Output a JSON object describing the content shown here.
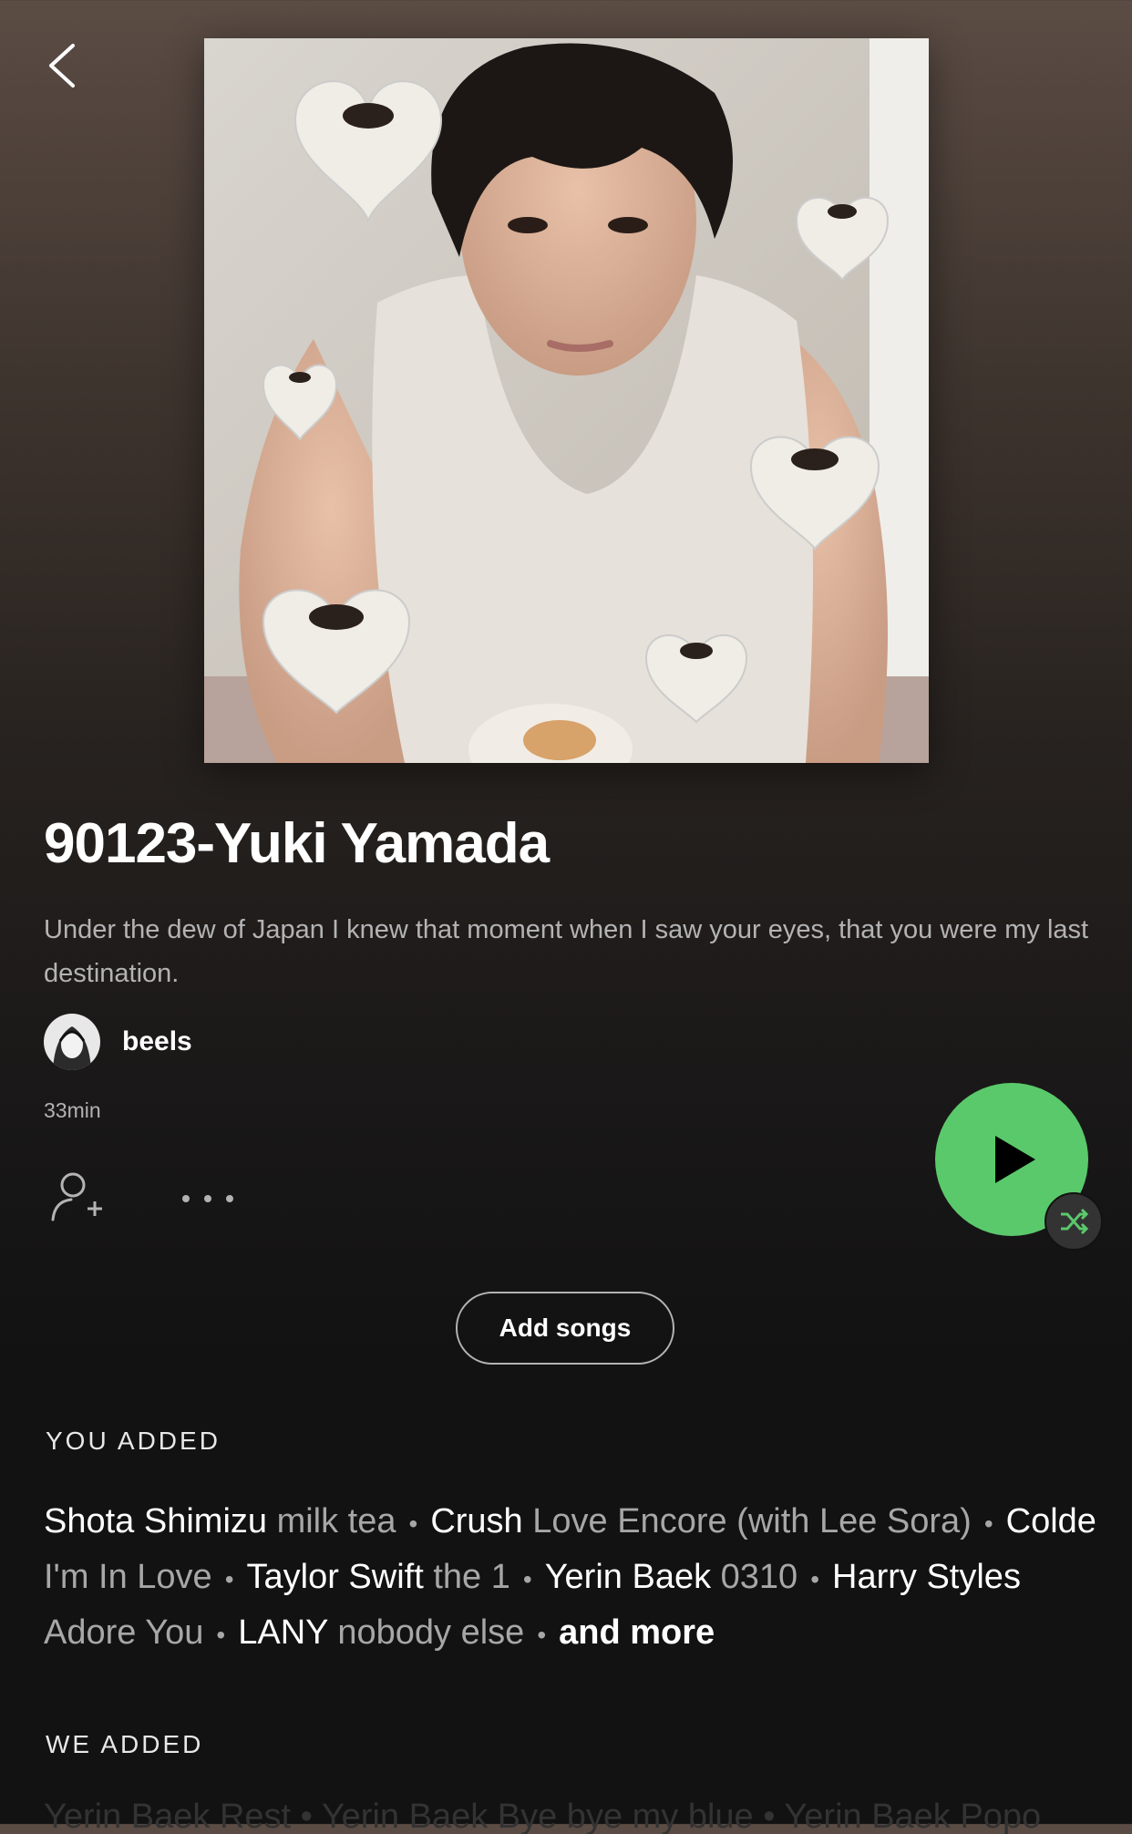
{
  "playlist": {
    "title": "90123-Yuki Yamada",
    "description": "Under the dew of Japan I knew that moment when I saw your eyes, that you were my last destination.",
    "owner": "beels",
    "duration": "33min"
  },
  "actions": {
    "add_songs_label": "Add songs"
  },
  "you_added": {
    "label": "YOU ADDED",
    "tracks": [
      {
        "artist": "Shota Shimizu",
        "song": "milk tea"
      },
      {
        "artist": "Crush",
        "song": "Love Encore (with Lee Sora)"
      },
      {
        "artist": "Colde",
        "song": "I'm In Love"
      },
      {
        "artist": "Taylor Swift",
        "song": "the 1"
      },
      {
        "artist": "Yerin Baek",
        "song": "0310"
      },
      {
        "artist": "Harry Styles",
        "song": "Adore You"
      },
      {
        "artist": "LANY",
        "song": "nobody else"
      }
    ],
    "and_more": "and more"
  },
  "we_added": {
    "label": "WE ADDED",
    "preview": "Yerin Baek Rest • Yerin Baek Bye bye my blue • Yerin Baek Popo"
  },
  "colors": {
    "play_button": "#5ac96b",
    "background": "#121212"
  },
  "icons": {
    "back": "chevron-left-icon",
    "follow": "add-user-icon",
    "more": "more-dots-icon",
    "play": "play-icon",
    "shuffle": "shuffle-icon"
  }
}
